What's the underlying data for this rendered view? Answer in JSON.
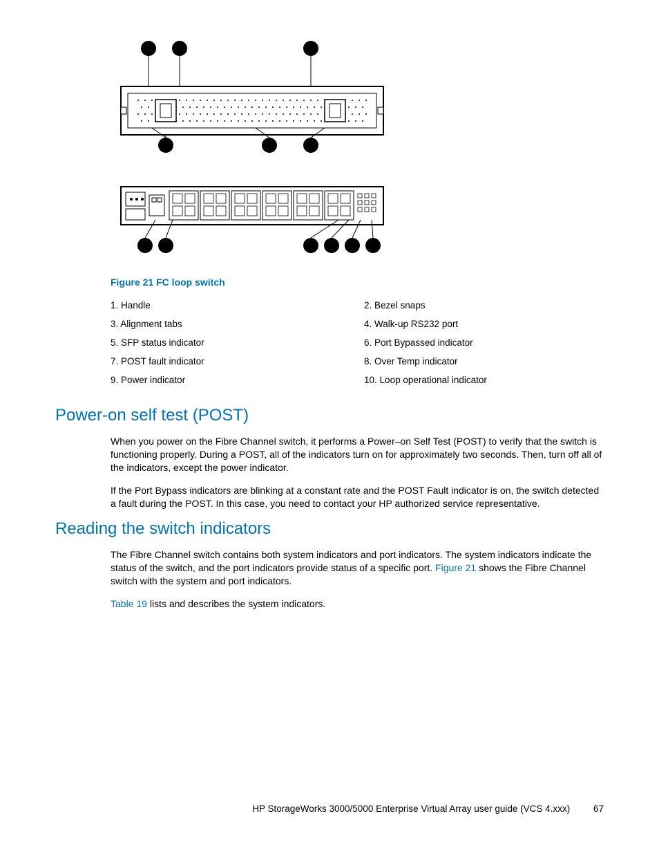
{
  "figure": {
    "caption": "Figure 21 FC loop switch",
    "legend": [
      {
        "num": "1.",
        "text": "Handle"
      },
      {
        "num": "2.",
        "text": "Bezel snaps"
      },
      {
        "num": "3.",
        "text": "Alignment tabs"
      },
      {
        "num": "4.",
        "text": "Walk-up RS232 port"
      },
      {
        "num": "5.",
        "text": "SFP status indicator"
      },
      {
        "num": "6.",
        "text": "Port Bypassed indicator"
      },
      {
        "num": "7.",
        "text": "POST fault indicator"
      },
      {
        "num": "8.",
        "text": "Over Temp indicator"
      },
      {
        "num": "9.",
        "text": "Power indicator"
      },
      {
        "num": "10.",
        "text": "Loop operational indicator"
      }
    ]
  },
  "sections": {
    "post": {
      "heading": "Power-on self test (POST)",
      "p1": "When you power on the Fibre Channel switch, it performs a Power–on Self Test (POST) to verify that the switch is functioning properly. During a POST, all of the indicators turn on for approximately two seconds. Then, turn off all of the indicators, except the power indicator.",
      "p2": "If the Port Bypass indicators are blinking at a constant rate and the POST Fault indicator is on, the switch detected a fault during the POST. In this case, you need to contact your HP authorized service representative."
    },
    "reading": {
      "heading": "Reading the switch indicators",
      "p1_a": "The Fibre Channel switch contains both system indicators and port indicators. The system indicators indicate the status of the switch, and the port indicators provide status of a specific port. ",
      "p1_link": "Figure 21",
      "p1_b": " shows the Fibre Channel switch with the system and port indicators.",
      "p2_link": "Table 19",
      "p2_b": " lists and describes the system indicators."
    }
  },
  "footer": {
    "text": "HP StorageWorks 3000/5000 Enterprise Virtual Array user guide (VCS 4.xxx)",
    "page": "67"
  }
}
